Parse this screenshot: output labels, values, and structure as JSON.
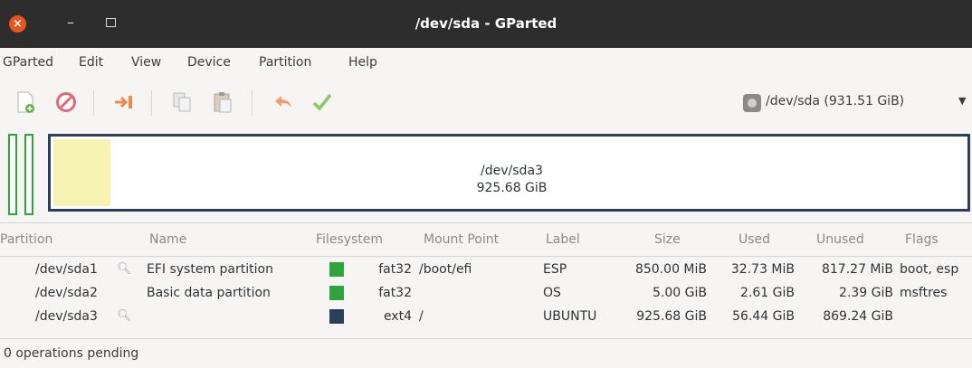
{
  "window": {
    "title": "/dev/sda - GParted"
  },
  "menu": [
    "GParted",
    "Edit",
    "View",
    "Device",
    "Partition",
    "Help"
  ],
  "toolbar": {
    "buttons": [
      "new-partition-icon",
      "delete-icon",
      "resize-move-icon",
      "copy-icon",
      "paste-icon",
      "undo-icon",
      "apply-icon"
    ]
  },
  "device_selector": {
    "label": "/dev/sda (931.51 GiB)"
  },
  "disk_visual": {
    "main_partition_name": "/dev/sda3",
    "main_partition_size": "925.68 GiB",
    "colors": {
      "fat32": "#2fa33c",
      "ext4": "#2b3f5b",
      "used": "#f7f3b3"
    }
  },
  "table": {
    "columns": [
      "Partition",
      "Name",
      "Filesystem",
      "Mount Point",
      "Label",
      "Size",
      "Used",
      "Unused",
      "Flags"
    ],
    "rows": [
      {
        "partition": "/dev/sda1",
        "name": "EFI system partition",
        "filesystem": "fat32",
        "mount_point": "/boot/efi",
        "label": "ESP",
        "size": "850.00 MiB",
        "used": "32.73 MiB",
        "unused": "817.27 MiB",
        "flags": "boot, esp",
        "fs_color": "#2fa33c",
        "locked": true
      },
      {
        "partition": "/dev/sda2",
        "name": "Basic data partition",
        "filesystem": "fat32",
        "mount_point": "",
        "label": "OS",
        "size": "5.00 GiB",
        "used": "2.61 GiB",
        "unused": "2.39 GiB",
        "flags": "msftres",
        "fs_color": "#2fa33c",
        "locked": false
      },
      {
        "partition": "/dev/sda3",
        "name": "",
        "filesystem": "ext4",
        "mount_point": "/",
        "label": "UBUNTU",
        "size": "925.68 GiB",
        "used": "56.44 GiB",
        "unused": "869.24 GiB",
        "flags": "",
        "fs_color": "#2b3f5b",
        "locked": true
      }
    ]
  },
  "status": {
    "text": "0 operations pending"
  }
}
